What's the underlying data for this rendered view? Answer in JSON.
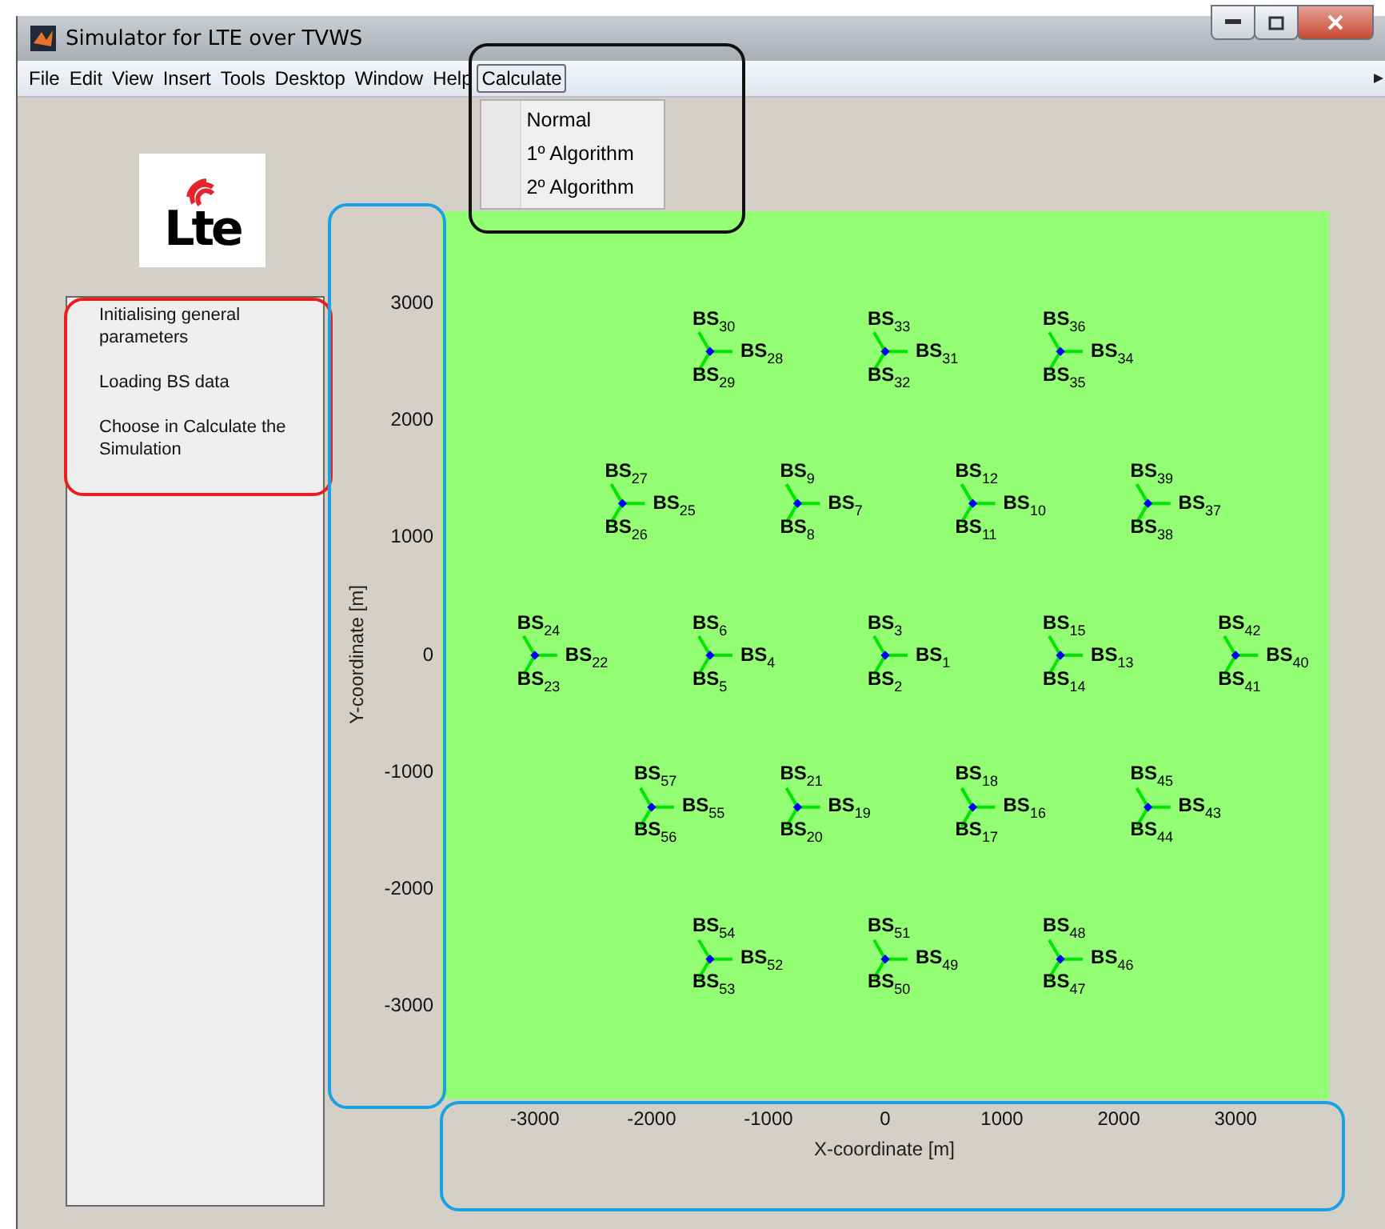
{
  "window": {
    "title": "Simulator for LTE over TVWS"
  },
  "menu_bar": [
    {
      "label": "File",
      "selected": false
    },
    {
      "label": "Edit",
      "selected": false
    },
    {
      "label": "View",
      "selected": false
    },
    {
      "label": "Insert",
      "selected": false
    },
    {
      "label": "Tools",
      "selected": false
    },
    {
      "label": "Desktop",
      "selected": false
    },
    {
      "label": "Window",
      "selected": false
    },
    {
      "label": "Help",
      "selected": false
    },
    {
      "label": "Calculate",
      "selected": true,
      "items": [
        "Normal",
        "1º Algorithm",
        "2º Algorithm"
      ]
    }
  ],
  "logo": {
    "text": "Lte"
  },
  "log": [
    "Initialising general parameters",
    "Loading BS data",
    "Choose in Calculate the Simulation"
  ],
  "plot": {
    "chart_data": {
      "type": "scatter",
      "xlabel": "X-coordinate [m]",
      "ylabel": "Y-coordinate [m]",
      "xlim": [
        -3800,
        3800
      ],
      "ylim": [
        -3800,
        3800
      ],
      "xticks": [
        -3000,
        -2000,
        -1000,
        0,
        1000,
        2000,
        3000
      ],
      "yticks": [
        3000,
        2000,
        1000,
        0,
        -1000,
        -2000,
        -3000
      ],
      "x": [
        -1500,
        0,
        1500,
        -2250,
        -750,
        750,
        2250,
        -3000,
        -1500,
        0,
        1500,
        3000,
        -2000,
        -750,
        750,
        2250,
        -1500,
        0,
        1500
      ],
      "series": [
        {
          "color": "#0000ff",
          "values": [
            2600,
            2600,
            2600,
            1300,
            1300,
            1300,
            1300,
            0,
            0,
            0,
            0,
            0,
            -1300,
            -1300,
            -1300,
            -1300,
            -2600,
            -2600,
            -2600
          ]
        }
      ]
    },
    "sites": [
      {
        "labels": [
          "BS$_{30}$",
          "BS$_{28}$",
          "BS$_{29}$"
        ]
      },
      {
        "labels": [
          "BS$_{33}$",
          "BS$_{31}$",
          "BS$_{32}$"
        ]
      },
      {
        "labels": [
          "BS$_{36}$",
          "BS$_{34}$",
          "BS$_{35}$"
        ]
      },
      {
        "labels": [
          "BS$_{27}$",
          "BS$_{25}$",
          "BS$_{26}$"
        ]
      },
      {
        "labels": [
          "BS$_{9}$",
          "BS$_{7}$",
          "BS$_{8}$"
        ]
      },
      {
        "labels": [
          "BS$_{12}$",
          "BS$_{10}$",
          "BS$_{11}$"
        ]
      },
      {
        "labels": [
          "BS$_{39}$",
          "BS$_{37}$",
          "BS$_{38}$"
        ]
      },
      {
        "labels": [
          "BS$_{24}$",
          "BS$_{22}$",
          "BS$_{23}$"
        ]
      },
      {
        "labels": [
          "BS$_{6}$",
          "BS$_{4}$",
          "BS$_{5}$"
        ]
      },
      {
        "labels": [
          "BS$_{3}$",
          "BS$_{1}$",
          "BS$_{2}$"
        ]
      },
      {
        "labels": [
          "BS$_{15}$",
          "BS$_{13}$",
          "BS$_{14}$"
        ]
      },
      {
        "labels": [
          "BS$_{42}$",
          "BS$_{40}$",
          "BS$_{41}$"
        ]
      },
      {
        "labels": [
          "BS$_{57}$",
          "BS$_{55}$",
          "BS$_{56}$"
        ]
      },
      {
        "labels": [
          "BS$_{21}$",
          "BS$_{19}$",
          "BS$_{20}$"
        ]
      },
      {
        "labels": [
          "BS$_{18}$",
          "BS$_{16}$",
          "BS$_{17}$"
        ]
      },
      {
        "labels": [
          "BS$_{45}$",
          "BS$_{43}$",
          "BS$_{44}$"
        ]
      },
      {
        "labels": [
          "BS$_{54}$",
          "BS$_{52}$",
          "BS$_{53}$"
        ]
      },
      {
        "labels": [
          "BS$_{51}$",
          "BS$_{49}$",
          "BS$_{50}$"
        ]
      },
      {
        "labels": [
          "BS$_{48}$",
          "BS$_{46}$",
          "BS$_{47}$"
        ]
      }
    ]
  },
  "highlight_frames": [
    {
      "kind": "menu",
      "color": "#111111"
    },
    {
      "kind": "log",
      "color": "#ee1c1c"
    },
    {
      "kind": "y_axis",
      "color": "#1ba1e2"
    },
    {
      "kind": "x_axis",
      "color": "#1ba1e2"
    }
  ]
}
